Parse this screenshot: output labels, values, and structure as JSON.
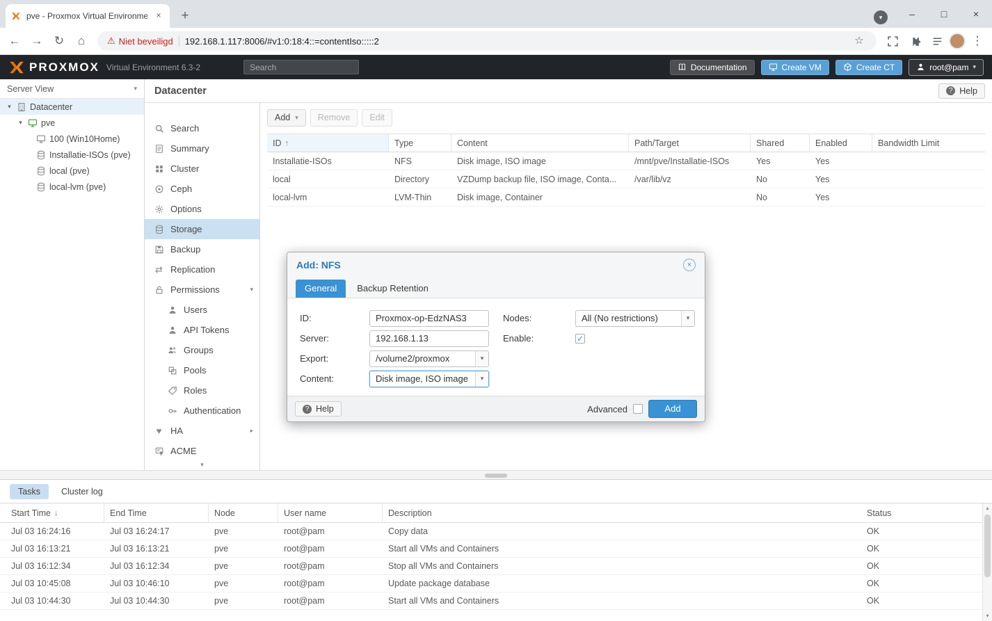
{
  "icons": {
    "back": "←",
    "forward": "→",
    "reload": "↻",
    "home": "⌂",
    "warning": "⚠",
    "star": "☆",
    "overflow": "⋮",
    "minimize": "–",
    "maximize": "□",
    "close": "×",
    "plus": "+",
    "caret_down": "▾",
    "caret_right": "▸",
    "sort_asc": "↑",
    "sort_desc": "↓",
    "check": "✓",
    "divider": "|",
    "sync": "⇄",
    "heart": "♥",
    "help": "?"
  },
  "colors": {
    "accent": "#3892d4",
    "proxmox_orange": "#e57000",
    "danger": "#c5221f"
  },
  "browser": {
    "tab_title": "pve - Proxmox Virtual Environme",
    "security_label": "Niet beveiligd",
    "url": "192.168.1.117:8006/#v1:0:18:4::=contentIso:::::2"
  },
  "app_header": {
    "logo": "PROXMOX",
    "subtitle": "Virtual Environment 6.3-2",
    "search_placeholder": "Search",
    "documentation_label": "Documentation",
    "create_vm_label": "Create VM",
    "create_ct_label": "Create CT",
    "user_label": "root@pam"
  },
  "sidebar": {
    "view_label": "Server View",
    "tree": [
      {
        "label": "Datacenter"
      },
      {
        "label": "pve"
      },
      {
        "label": "100 (Win10Home)"
      },
      {
        "label": "Installatie-ISOs (pve)"
      },
      {
        "label": "local (pve)"
      },
      {
        "label": "local-lvm (pve)"
      }
    ]
  },
  "nav": {
    "items": [
      {
        "label": "Search"
      },
      {
        "label": "Summary"
      },
      {
        "label": "Cluster"
      },
      {
        "label": "Ceph"
      },
      {
        "label": "Options"
      },
      {
        "label": "Storage"
      },
      {
        "label": "Backup"
      },
      {
        "label": "Replication"
      },
      {
        "label": "Permissions"
      },
      {
        "label": "Users"
      },
      {
        "label": "API Tokens"
      },
      {
        "label": "Groups"
      },
      {
        "label": "Pools"
      },
      {
        "label": "Roles"
      },
      {
        "label": "Authentication"
      },
      {
        "label": "HA"
      },
      {
        "label": "ACME"
      }
    ]
  },
  "content": {
    "title": "Datacenter",
    "help_label": "Help",
    "toolbar": {
      "add": "Add",
      "remove": "Remove",
      "edit": "Edit"
    },
    "storage_table": {
      "columns": [
        "ID",
        "Type",
        "Content",
        "Path/Target",
        "Shared",
        "Enabled",
        "Bandwidth Limit"
      ],
      "rows": [
        [
          "Installatie-ISOs",
          "NFS",
          "Disk image, ISO image",
          "/mnt/pve/Installatie-ISOs",
          "Yes",
          "Yes",
          ""
        ],
        [
          "local",
          "Directory",
          "VZDump backup file, ISO image, Conta...",
          "/var/lib/vz",
          "No",
          "Yes",
          ""
        ],
        [
          "local-lvm",
          "LVM-Thin",
          "Disk image, Container",
          "",
          "No",
          "Yes",
          ""
        ]
      ]
    }
  },
  "dialog": {
    "title": "Add: NFS",
    "tabs": [
      "General",
      "Backup Retention"
    ],
    "fields": {
      "id_label": "ID:",
      "id_value": "Proxmox-op-EdzNAS3",
      "server_label": "Server:",
      "server_value": "192.168.1.13",
      "export_label": "Export:",
      "export_value": "/volume2/proxmox",
      "content_label": "Content:",
      "content_value": "Disk image, ISO image",
      "nodes_label": "Nodes:",
      "nodes_value": "All (No restrictions)",
      "enable_label": "Enable:"
    },
    "footer": {
      "help": "Help",
      "advanced": "Advanced",
      "add": "Add"
    }
  },
  "tasks_panel": {
    "tabs": [
      "Tasks",
      "Cluster log"
    ],
    "columns": [
      "Start Time",
      "End Time",
      "Node",
      "User name",
      "Description",
      "Status"
    ],
    "rows": [
      [
        "Jul 03 16:24:16",
        "Jul 03 16:24:17",
        "pve",
        "root@pam",
        "Copy data",
        "OK"
      ],
      [
        "Jul 03 16:13:21",
        "Jul 03 16:13:21",
        "pve",
        "root@pam",
        "Start all VMs and Containers",
        "OK"
      ],
      [
        "Jul 03 16:12:34",
        "Jul 03 16:12:34",
        "pve",
        "root@pam",
        "Stop all VMs and Containers",
        "OK"
      ],
      [
        "Jul 03 10:45:08",
        "Jul 03 10:46:10",
        "pve",
        "root@pam",
        "Update package database",
        "OK"
      ],
      [
        "Jul 03 10:44:30",
        "Jul 03 10:44:30",
        "pve",
        "root@pam",
        "Start all VMs and Containers",
        "OK"
      ]
    ]
  }
}
